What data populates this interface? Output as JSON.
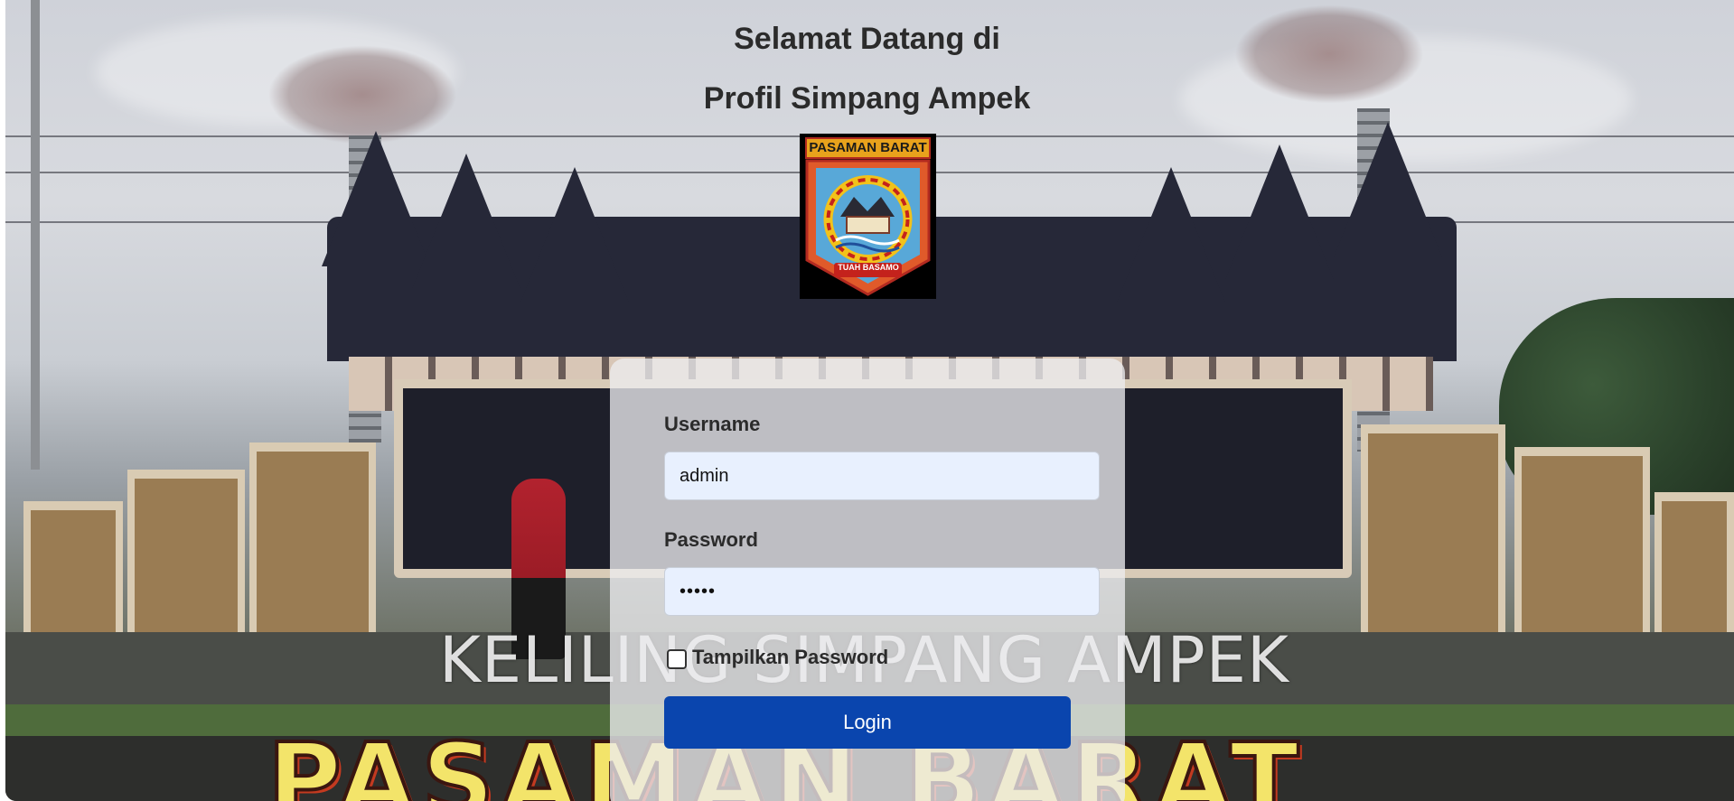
{
  "header": {
    "title_line1": "Selamat Datang di",
    "title_line2": "Profil Simpang Ampek"
  },
  "logo": {
    "label": "PASAMAN BARAT",
    "motto": "TUAH BASAMO"
  },
  "background": {
    "caption": "KELILING SIMPANG AMPEK",
    "banner": "PASAMAN BARAT"
  },
  "login_form": {
    "username_label": "Username",
    "username_value": "admin",
    "password_label": "Password",
    "password_value": "admin",
    "show_password_label": "Tampilkan Password",
    "show_password_checked": false,
    "login_button_label": "Login"
  },
  "colors": {
    "login_button": "#0a45ae",
    "input_background": "#e8f0fe",
    "card_background": "rgba(236,236,238,0.78)"
  }
}
